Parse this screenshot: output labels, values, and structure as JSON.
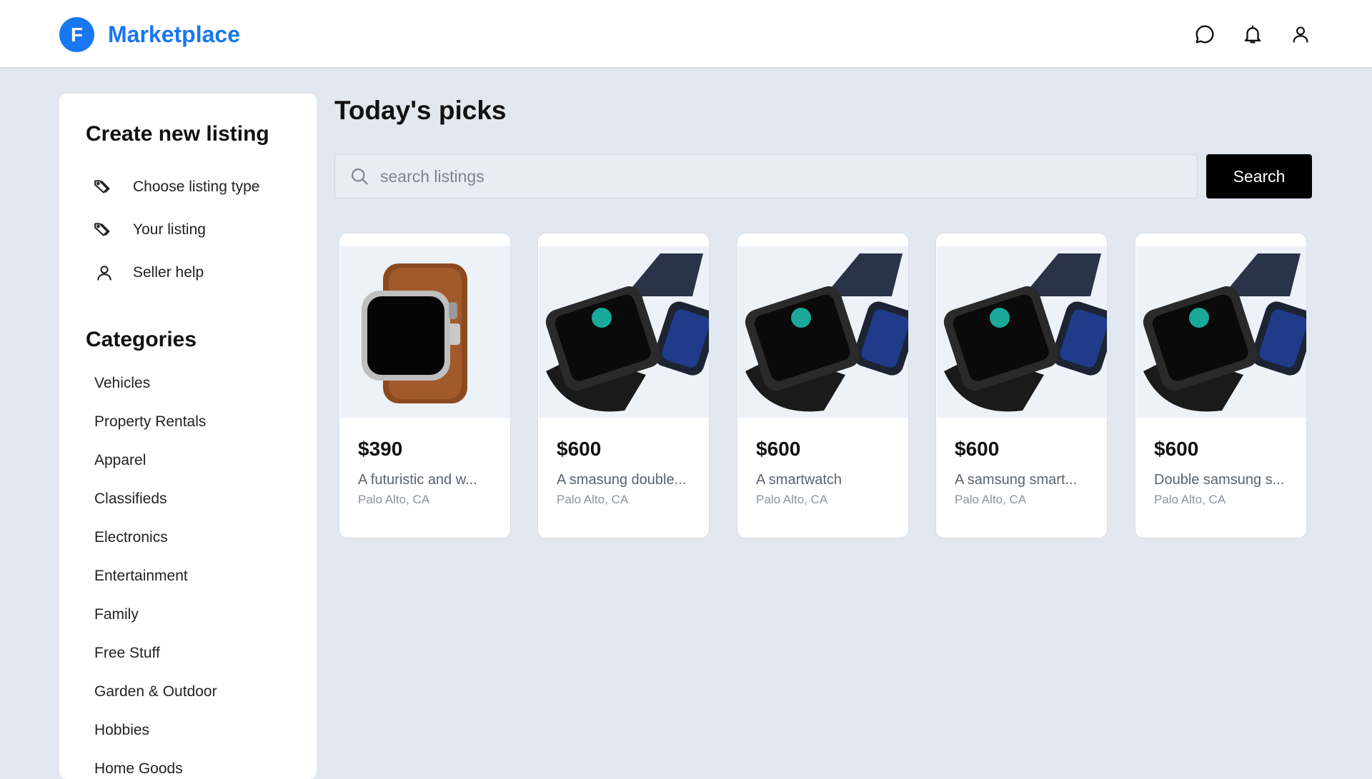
{
  "header": {
    "logo_letter": "F",
    "brand": "Marketplace",
    "icons": [
      "messenger-icon",
      "bell-icon",
      "user-icon"
    ]
  },
  "sidebar": {
    "create_title": "Create new listing",
    "actions": [
      {
        "label": "Choose listing type",
        "icon": "tag-icon"
      },
      {
        "label": "Your listing",
        "icon": "tag-icon"
      },
      {
        "label": "Seller help",
        "icon": "user-icon"
      }
    ],
    "categories_title": "Categories",
    "categories": [
      "Vehicles",
      "Property Rentals",
      "Apparel",
      "Classifieds",
      "Electronics",
      "Entertainment",
      "Family",
      "Free Stuff",
      "Garden & Outdoor",
      "Hobbies",
      "Home Goods"
    ]
  },
  "main": {
    "title": "Today's picks",
    "search": {
      "placeholder": "search listings",
      "value": "",
      "button": "Search"
    },
    "listings": [
      {
        "price": "$390",
        "title": "A futuristic and w...",
        "location": "Palo Alto, CA",
        "image": "brown-leather-smartwatch"
      },
      {
        "price": "$600",
        "title": "A smasung double...",
        "location": "Palo Alto, CA",
        "image": "dual-black-smartwatch"
      },
      {
        "price": "$600",
        "title": "A smartwatch",
        "location": "Palo Alto, CA",
        "image": "dual-black-smartwatch"
      },
      {
        "price": "$600",
        "title": "A samsung smart...",
        "location": "Palo Alto, CA",
        "image": "dual-black-smartwatch"
      },
      {
        "price": "$600",
        "title": "Double samsung s...",
        "location": "Palo Alto, CA",
        "image": "dual-black-smartwatch"
      }
    ]
  },
  "colors": {
    "brand": "#1877f2",
    "background": "#e2e8f0",
    "button": "#000000"
  }
}
